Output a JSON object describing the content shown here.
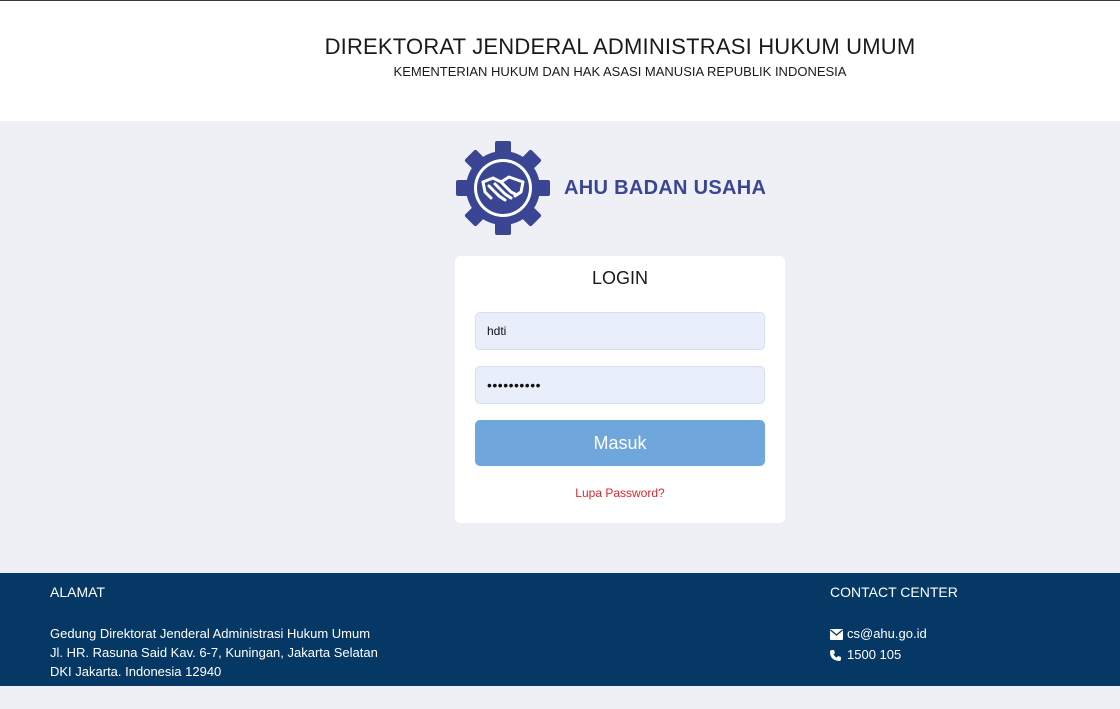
{
  "header": {
    "title": "DIREKTORAT JENDERAL ADMINISTRASI HUKUM UMUM",
    "subtitle": "KEMENTERIAN HUKUM DAN HAK ASASI MANUSIA REPUBLIK INDONESIA"
  },
  "logo": {
    "text": "AHU BADAN USAHA",
    "icon": "gear-handshake-icon",
    "color": "#3a4694"
  },
  "login": {
    "heading": "LOGIN",
    "username_value": "hdti",
    "password_value": "••••••••••",
    "submit_label": "Masuk",
    "forgot_label": "Lupa Password?"
  },
  "footer": {
    "address_heading": "ALAMAT",
    "address_lines": [
      "Gedung Direktorat Jenderal Administrasi Hukum Umum",
      "Jl. HR. Rasuna Said Kav. 6-7, Kuningan, Jakarta Selatan",
      "DKI Jakarta. Indonesia 12940"
    ],
    "contact_heading": "CONTACT CENTER",
    "email": "cs@ahu.go.id",
    "phone": "1500 105"
  },
  "colors": {
    "footer_bg": "#053864",
    "button_bg": "#6fa7dc",
    "link": "#e0262d",
    "page_bg": "#eef0f6"
  }
}
